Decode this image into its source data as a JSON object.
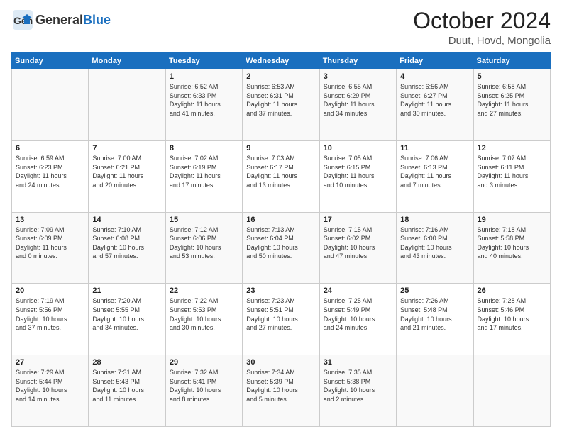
{
  "header": {
    "logo_general": "General",
    "logo_blue": "Blue",
    "month_year": "October 2024",
    "location": "Duut, Hovd, Mongolia"
  },
  "calendar": {
    "days_of_week": [
      "Sunday",
      "Monday",
      "Tuesday",
      "Wednesday",
      "Thursday",
      "Friday",
      "Saturday"
    ],
    "weeks": [
      [
        {
          "day": "",
          "info": ""
        },
        {
          "day": "",
          "info": ""
        },
        {
          "day": "1",
          "info": "Sunrise: 6:52 AM\nSunset: 6:33 PM\nDaylight: 11 hours\nand 41 minutes."
        },
        {
          "day": "2",
          "info": "Sunrise: 6:53 AM\nSunset: 6:31 PM\nDaylight: 11 hours\nand 37 minutes."
        },
        {
          "day": "3",
          "info": "Sunrise: 6:55 AM\nSunset: 6:29 PM\nDaylight: 11 hours\nand 34 minutes."
        },
        {
          "day": "4",
          "info": "Sunrise: 6:56 AM\nSunset: 6:27 PM\nDaylight: 11 hours\nand 30 minutes."
        },
        {
          "day": "5",
          "info": "Sunrise: 6:58 AM\nSunset: 6:25 PM\nDaylight: 11 hours\nand 27 minutes."
        }
      ],
      [
        {
          "day": "6",
          "info": "Sunrise: 6:59 AM\nSunset: 6:23 PM\nDaylight: 11 hours\nand 24 minutes."
        },
        {
          "day": "7",
          "info": "Sunrise: 7:00 AM\nSunset: 6:21 PM\nDaylight: 11 hours\nand 20 minutes."
        },
        {
          "day": "8",
          "info": "Sunrise: 7:02 AM\nSunset: 6:19 PM\nDaylight: 11 hours\nand 17 minutes."
        },
        {
          "day": "9",
          "info": "Sunrise: 7:03 AM\nSunset: 6:17 PM\nDaylight: 11 hours\nand 13 minutes."
        },
        {
          "day": "10",
          "info": "Sunrise: 7:05 AM\nSunset: 6:15 PM\nDaylight: 11 hours\nand 10 minutes."
        },
        {
          "day": "11",
          "info": "Sunrise: 7:06 AM\nSunset: 6:13 PM\nDaylight: 11 hours\nand 7 minutes."
        },
        {
          "day": "12",
          "info": "Sunrise: 7:07 AM\nSunset: 6:11 PM\nDaylight: 11 hours\nand 3 minutes."
        }
      ],
      [
        {
          "day": "13",
          "info": "Sunrise: 7:09 AM\nSunset: 6:09 PM\nDaylight: 11 hours\nand 0 minutes."
        },
        {
          "day": "14",
          "info": "Sunrise: 7:10 AM\nSunset: 6:08 PM\nDaylight: 10 hours\nand 57 minutes."
        },
        {
          "day": "15",
          "info": "Sunrise: 7:12 AM\nSunset: 6:06 PM\nDaylight: 10 hours\nand 53 minutes."
        },
        {
          "day": "16",
          "info": "Sunrise: 7:13 AM\nSunset: 6:04 PM\nDaylight: 10 hours\nand 50 minutes."
        },
        {
          "day": "17",
          "info": "Sunrise: 7:15 AM\nSunset: 6:02 PM\nDaylight: 10 hours\nand 47 minutes."
        },
        {
          "day": "18",
          "info": "Sunrise: 7:16 AM\nSunset: 6:00 PM\nDaylight: 10 hours\nand 43 minutes."
        },
        {
          "day": "19",
          "info": "Sunrise: 7:18 AM\nSunset: 5:58 PM\nDaylight: 10 hours\nand 40 minutes."
        }
      ],
      [
        {
          "day": "20",
          "info": "Sunrise: 7:19 AM\nSunset: 5:56 PM\nDaylight: 10 hours\nand 37 minutes."
        },
        {
          "day": "21",
          "info": "Sunrise: 7:20 AM\nSunset: 5:55 PM\nDaylight: 10 hours\nand 34 minutes."
        },
        {
          "day": "22",
          "info": "Sunrise: 7:22 AM\nSunset: 5:53 PM\nDaylight: 10 hours\nand 30 minutes."
        },
        {
          "day": "23",
          "info": "Sunrise: 7:23 AM\nSunset: 5:51 PM\nDaylight: 10 hours\nand 27 minutes."
        },
        {
          "day": "24",
          "info": "Sunrise: 7:25 AM\nSunset: 5:49 PM\nDaylight: 10 hours\nand 24 minutes."
        },
        {
          "day": "25",
          "info": "Sunrise: 7:26 AM\nSunset: 5:48 PM\nDaylight: 10 hours\nand 21 minutes."
        },
        {
          "day": "26",
          "info": "Sunrise: 7:28 AM\nSunset: 5:46 PM\nDaylight: 10 hours\nand 17 minutes."
        }
      ],
      [
        {
          "day": "27",
          "info": "Sunrise: 7:29 AM\nSunset: 5:44 PM\nDaylight: 10 hours\nand 14 minutes."
        },
        {
          "day": "28",
          "info": "Sunrise: 7:31 AM\nSunset: 5:43 PM\nDaylight: 10 hours\nand 11 minutes."
        },
        {
          "day": "29",
          "info": "Sunrise: 7:32 AM\nSunset: 5:41 PM\nDaylight: 10 hours\nand 8 minutes."
        },
        {
          "day": "30",
          "info": "Sunrise: 7:34 AM\nSunset: 5:39 PM\nDaylight: 10 hours\nand 5 minutes."
        },
        {
          "day": "31",
          "info": "Sunrise: 7:35 AM\nSunset: 5:38 PM\nDaylight: 10 hours\nand 2 minutes."
        },
        {
          "day": "",
          "info": ""
        },
        {
          "day": "",
          "info": ""
        }
      ]
    ]
  }
}
